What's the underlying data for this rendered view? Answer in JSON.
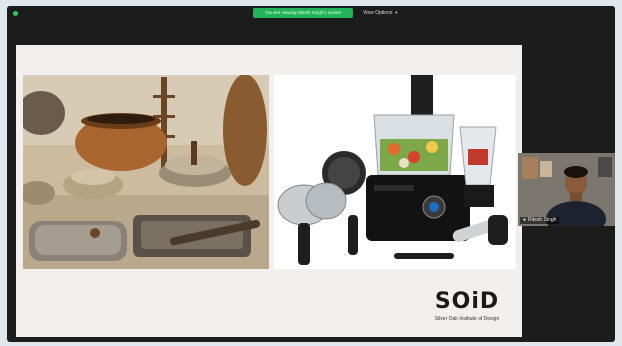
{
  "meeting": {
    "share_banner": "You are viewing Ritesh Singh's screen",
    "view_options_label": "View Options",
    "view_options_icon": "chevron-down-icon"
  },
  "slide": {
    "logo_text": "SOiD",
    "logo_subtext": "Silver Oak Institute of Design"
  },
  "participant": {
    "name": "Ritesh Singh",
    "mic_icon": "mic-icon"
  },
  "colors": {
    "banner_green": "#23b35a",
    "status_green": "#23d160",
    "logo_red": "#b8262a",
    "background_dark": "#1c1c1c"
  }
}
